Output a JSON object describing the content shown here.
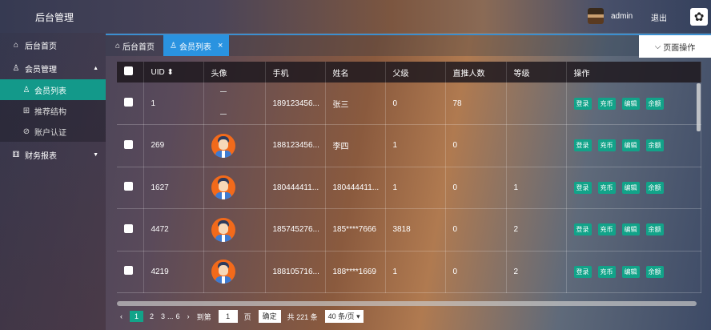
{
  "header": {
    "title": "后台管理",
    "username": "admin",
    "logout": "退出",
    "menu_icon": "flower-icon"
  },
  "sidebar": {
    "home": "后台首页",
    "member": "会员管理",
    "member_list": "会员列表",
    "referral": "推荐结构",
    "account_verify": "账户认证",
    "finance": "财务报表"
  },
  "tabs": {
    "home": "后台首页",
    "member_list": "会员列表",
    "page_ops": "页面操作"
  },
  "table": {
    "headers": [
      "UID",
      "头像",
      "手机",
      "姓名",
      "父级",
      "直推人数",
      "等级",
      "操作"
    ],
    "rows": [
      {
        "uid": "1",
        "phone": "189123456...",
        "name": "张三",
        "parent": "0",
        "direct": "78",
        "level": "",
        "avatar": false
      },
      {
        "uid": "269",
        "phone": "188123456...",
        "name": "李四",
        "parent": "1",
        "direct": "0",
        "level": "",
        "avatar": true
      },
      {
        "uid": "1627",
        "phone": "180444411...",
        "name": "180444411...",
        "parent": "1",
        "direct": "0",
        "level": "1",
        "avatar": true
      },
      {
        "uid": "4472",
        "phone": "185745276...",
        "name": "185****7666",
        "parent": "3818",
        "direct": "0",
        "level": "2",
        "avatar": true
      },
      {
        "uid": "4219",
        "phone": "188105716...",
        "name": "188****1669",
        "parent": "1",
        "direct": "0",
        "level": "2",
        "avatar": true
      }
    ],
    "actions": [
      "登录",
      "充币",
      "编辑",
      "余额"
    ]
  },
  "pager": {
    "pages": [
      "1",
      "2",
      "3",
      "...",
      "6"
    ],
    "goto": "到第",
    "page_value": "1",
    "page_unit": "页",
    "confirm": "确定",
    "total": "共 221 条",
    "per_page": "40 条/页"
  },
  "colors": {
    "accent": "#12a389",
    "tab_active": "#2a93e0"
  }
}
